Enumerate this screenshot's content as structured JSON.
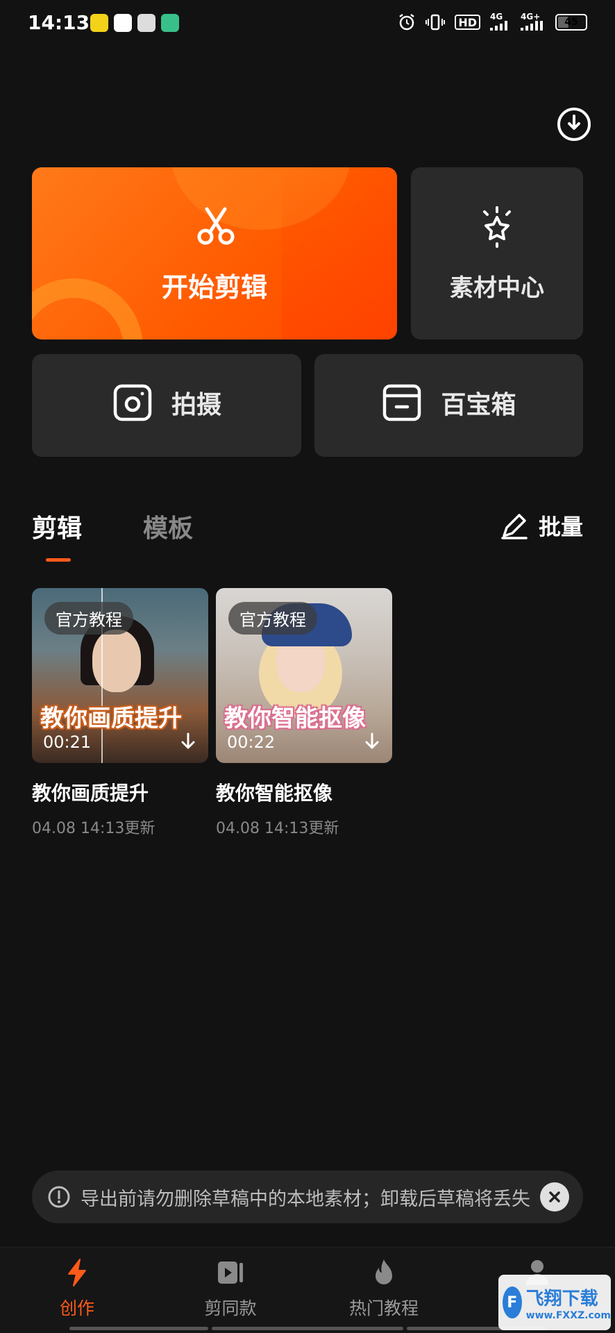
{
  "status_bar": {
    "time": "14:13",
    "battery": "45",
    "battery_level": 0.45,
    "network_1": "4G",
    "network_2": "4G+",
    "hd": "HD"
  },
  "actions": {
    "start_edit": "开始剪辑",
    "material_center": "素材中心",
    "shoot": "拍摄",
    "toolbox": "百宝箱"
  },
  "tabs": {
    "items": [
      {
        "label": "剪辑",
        "active": true
      },
      {
        "label": "模板",
        "active": false
      }
    ],
    "batch": "批量"
  },
  "drafts": [
    {
      "badge": "官方教程",
      "overlay_title": "教你画质提升",
      "duration": "00:21",
      "name": "教你画质提升",
      "updated": "04.08 14:13更新"
    },
    {
      "badge": "官方教程",
      "overlay_title": "教你智能抠像",
      "duration": "00:22",
      "name": "教你智能抠像",
      "updated": "04.08 14:13更新"
    }
  ],
  "notice": {
    "text": "导出前请勿删除草稿中的本地素材；卸载后草稿将丢失"
  },
  "bottom_nav": [
    {
      "label": "创作",
      "icon": "lightning-icon",
      "active": true
    },
    {
      "label": "剪同款",
      "icon": "video-template-icon",
      "active": false
    },
    {
      "label": "热门教程",
      "icon": "flame-icon",
      "active": false
    },
    {
      "label": "",
      "icon": "profile-icon",
      "active": false
    }
  ],
  "watermark": {
    "title": "飞翔下载",
    "sub": "www.FXXZ.com"
  },
  "colors": {
    "accent": "#ff5a1a",
    "background": "#121212",
    "card": "#2a2a2a"
  }
}
